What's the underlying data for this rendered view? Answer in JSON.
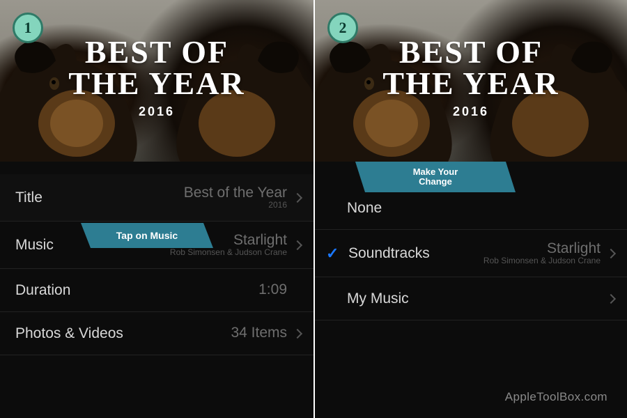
{
  "hero": {
    "title_line1": "BEST OF",
    "title_line2": "THE YEAR",
    "year": "2016"
  },
  "steps": {
    "one": "1",
    "two": "2"
  },
  "panel1": {
    "annotation": "Tap on Music",
    "rows": {
      "title": {
        "label": "Title",
        "v1": "Best of the Year",
        "v2": "2016"
      },
      "music": {
        "label": "Music",
        "v1": "Starlight",
        "v2": "Rob Simonsen & Judson Crane"
      },
      "duration": {
        "label": "Duration",
        "v1": "1:09"
      },
      "photos": {
        "label": "Photos & Videos",
        "v1": "34 Items"
      }
    }
  },
  "panel2": {
    "annotation": "Make Your\nChange",
    "rows": {
      "none": {
        "label": "None"
      },
      "soundtracks": {
        "label": "Soundtracks",
        "v1": "Starlight",
        "v2": "Rob Simonsen & Judson Crane"
      },
      "mymusic": {
        "label": "My Music"
      }
    }
  },
  "watermark": "AppleToolBox.com"
}
